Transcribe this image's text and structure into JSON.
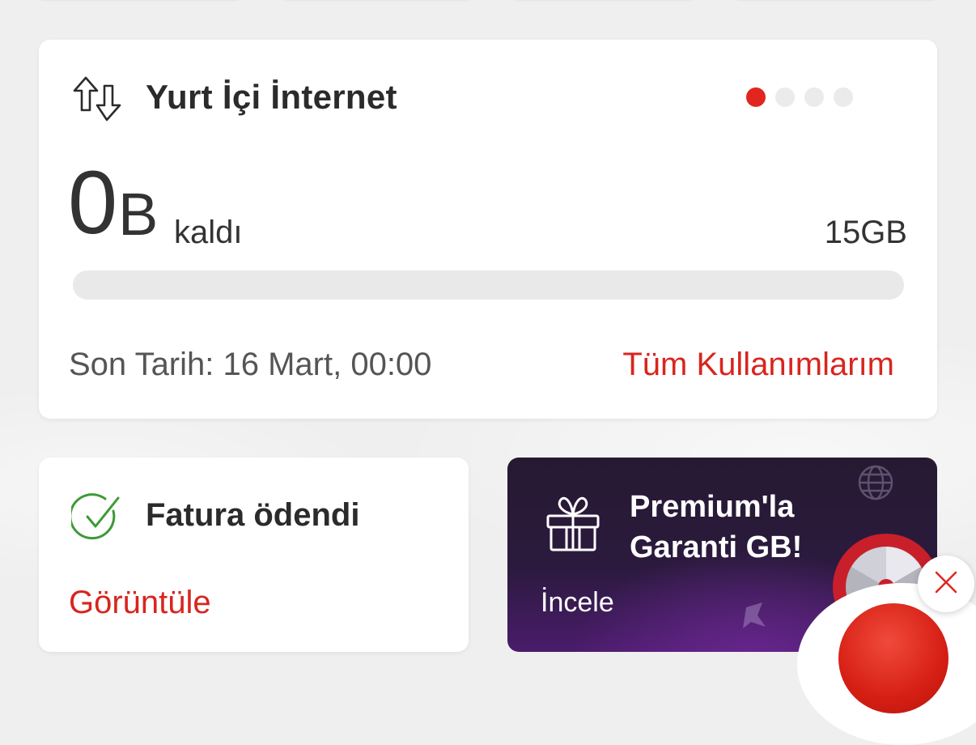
{
  "internet_card": {
    "title": "Yurt İçi İnternet",
    "carousel_total": 4,
    "carousel_active": 0,
    "remaining_value": "0",
    "remaining_unit": "B",
    "remaining_label": "kaldı",
    "total": "15GB",
    "usage_fraction_remaining": 0.0,
    "due_date": "Son Tarih: 16 Mart, 00:00",
    "all_usage_link": "Tüm Kullanımlarım",
    "icon": "data-transfer-arrows-icon"
  },
  "bill_card": {
    "title": "Fatura ödendi",
    "link": "Görüntüle",
    "icon": "check-circle-icon"
  },
  "promo_card": {
    "title": "Premium'la Garanti GB!",
    "link": "İncele",
    "icon": "gift-icon"
  },
  "colors": {
    "accent": "#e0261f",
    "link": "#d8251e",
    "success": "#3d9a36",
    "promo_bg": "#2b1a3d"
  }
}
